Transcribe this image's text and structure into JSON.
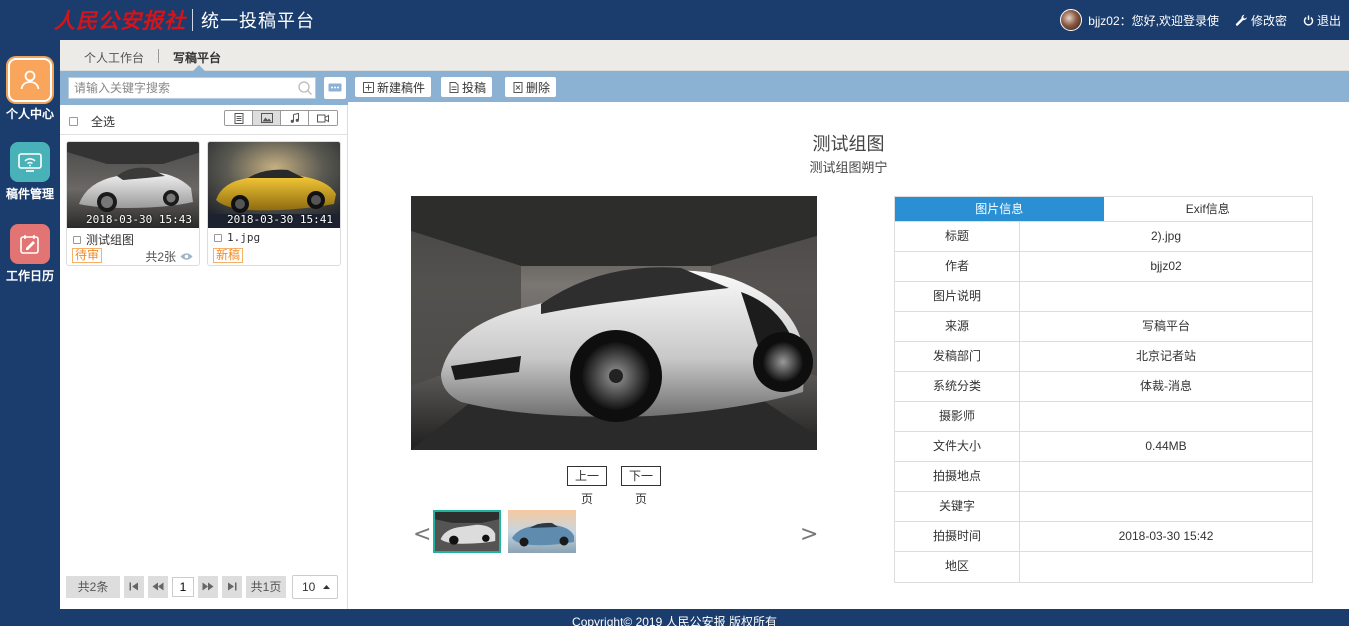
{
  "header": {
    "logo_text": "人民公安报社",
    "platform_name": "统一投稿平台",
    "greeting": "bjjz02：您好,欢迎登录使",
    "change_password": "修改密",
    "logout": "退出"
  },
  "nav": {
    "items": [
      {
        "label": "个人中心",
        "icon": "user-icon"
      },
      {
        "label": "稿件管理",
        "icon": "wifi-monitor-icon"
      },
      {
        "label": "工作日历",
        "icon": "calendar-edit-icon"
      }
    ]
  },
  "tabs": {
    "items": [
      {
        "label": "个人工作台"
      },
      {
        "label": "写稿平台"
      }
    ]
  },
  "left": {
    "search_placeholder": "请输入关键字搜索",
    "select_all": "全选",
    "cards": [
      {
        "timestamp": "2018-03-30 15:43",
        "title": "测试组图",
        "badge": "待审",
        "count": "共2张"
      },
      {
        "timestamp": "2018-03-30 15:41",
        "title": "1.jpg",
        "badge": "新稿"
      }
    ],
    "pager": {
      "total": "共2条",
      "current": "1",
      "pages": "共1页",
      "size": "10"
    }
  },
  "toolbar": {
    "new": "新建稿件",
    "submit": "投稿",
    "delete": "删除"
  },
  "detail": {
    "title": "测试组图",
    "subtitle": "测试组图朔宁",
    "prev": "上一",
    "prev_sub": "页",
    "next": "下一",
    "next_sub": "页",
    "arrow_left": "<",
    "arrow_right": ">"
  },
  "info": {
    "tabs": [
      "图片信息",
      "Exif信息"
    ],
    "rows": [
      {
        "label": "标题",
        "value": "2).jpg"
      },
      {
        "label": "作者",
        "value": "bjjz02"
      },
      {
        "label": "图片说明",
        "value": ""
      },
      {
        "label": "来源",
        "value": "写稿平台"
      },
      {
        "label": "发稿部门",
        "value": "北京记者站"
      },
      {
        "label": "系统分类",
        "value": "体裁-消息"
      },
      {
        "label": "摄影师",
        "value": ""
      },
      {
        "label": "文件大小",
        "value": "0.44MB"
      },
      {
        "label": "拍摄地点",
        "value": ""
      },
      {
        "label": "关键字",
        "value": ""
      },
      {
        "label": "拍摄时间",
        "value": "2018-03-30 15:42"
      },
      {
        "label": "地区",
        "value": ""
      }
    ]
  },
  "footer": {
    "copyright": "Copyright© 2019 人民公安报 版权所有"
  },
  "colors": {
    "header_bg": "#1a3d6e",
    "toolbar_bg": "#8bb1d3",
    "tab_active": "#2b8fd4",
    "badge": "#f08a24"
  }
}
